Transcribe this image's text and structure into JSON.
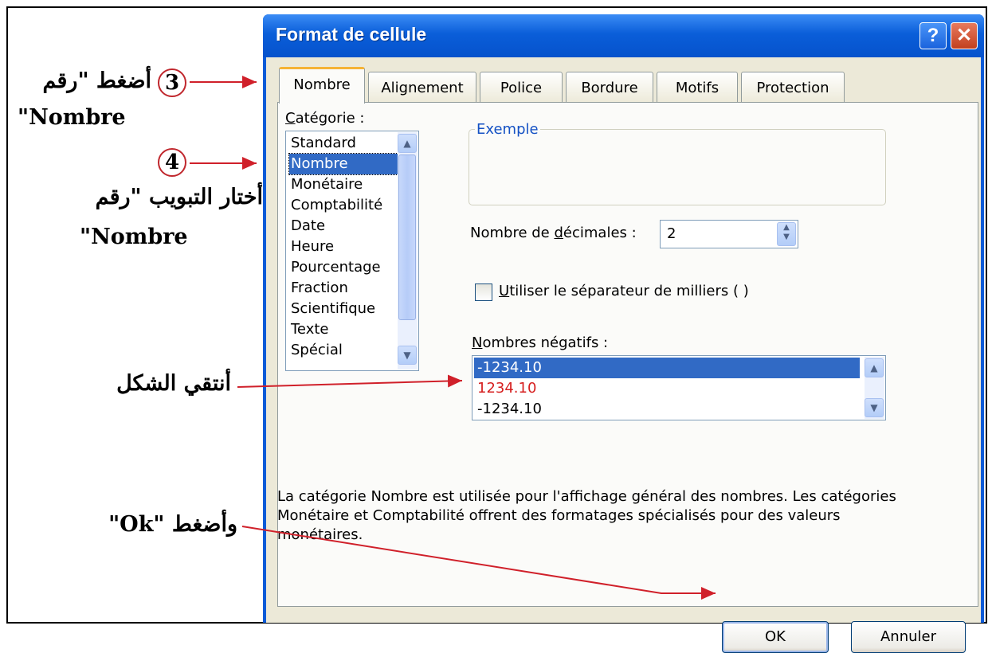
{
  "dialog": {
    "title": "Format de cellule",
    "help_glyph": "?",
    "close_glyph": "✕",
    "tabs": [
      "Nombre",
      "Alignement",
      "Police",
      "Bordure",
      "Motifs",
      "Protection"
    ],
    "active_tab": "Nombre",
    "category": {
      "label_first": "C",
      "label_rest": "atégorie :",
      "items": [
        "Standard",
        "Nombre",
        "Monétaire",
        "Comptabilité",
        "Date",
        "Heure",
        "Pourcentage",
        "Fraction",
        "Scientifique",
        "Texte",
        "Spécial"
      ],
      "selected": "Nombre"
    },
    "example_label": "Exemple",
    "decimals": {
      "label_pre": "Nombre de ",
      "label_u": "d",
      "label_post": "écimales :",
      "value": "2"
    },
    "thousands": {
      "label_u": "U",
      "label_rest": "tiliser le séparateur de milliers ( )",
      "checked": false
    },
    "negatives": {
      "label_u": "N",
      "label_rest": "ombres négatifs :",
      "items": [
        "-1234.10",
        "1234.10",
        "-1234.10"
      ],
      "item_colors": [
        "#ffffff",
        "#d61f1f",
        "#000000"
      ],
      "selected_index": 0
    },
    "description": "La catégorie Nombre est utilisée pour l'affichage général des nombres. Les catégories Monétaire et Comptabilité offrent des formatages spécialisés pour des valeurs monétaires.",
    "ok_label": "OK",
    "cancel_label": "Annuler"
  },
  "annotations": {
    "step3_number": "3",
    "step3_line1": "أضغط \"رقم",
    "step3_line2": "\"Nombre",
    "step4_number": "4",
    "step4_line1": "أختار التبويب \"رقم",
    "step4_line2": "\"Nombre",
    "pick_format": "أنتقي الشكل",
    "press_ok": "وأضغط \"Ok\""
  },
  "colors": {
    "title_bar": "#0a5ed9",
    "selection": "#316ac5",
    "arrow": "#d0202a"
  }
}
